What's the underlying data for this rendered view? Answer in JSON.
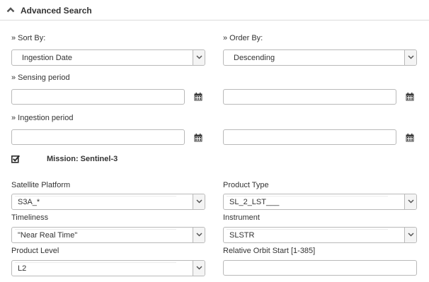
{
  "header": {
    "title": "Advanced Search",
    "icon": "chevron-up-icon"
  },
  "sort": {
    "label": "» Sort By:",
    "value": "Ingestion Date"
  },
  "order": {
    "label": "» Order By:",
    "value": "Descending"
  },
  "sensing": {
    "label": "» Sensing period",
    "start": "",
    "end": ""
  },
  "ingestion": {
    "label": "» Ingestion period",
    "start": "",
    "end": ""
  },
  "mission": {
    "label": "Mission: Sentinel-3",
    "checked": true
  },
  "fields": {
    "satellite_platform": {
      "label": "Satellite Platform",
      "value": "S3A_*"
    },
    "product_type": {
      "label": "Product Type",
      "value": "SL_2_LST___"
    },
    "timeliness": {
      "label": "Timeliness",
      "value": "\"Near Real Time\""
    },
    "instrument": {
      "label": "Instrument",
      "value": "SLSTR"
    },
    "product_level": {
      "label": "Product Level",
      "value": "L2"
    },
    "relative_orbit": {
      "label": "Relative Orbit Start [1-385]",
      "value": ""
    }
  },
  "icons": [
    "chevron-up-icon",
    "calendar-icon",
    "chevron-down-icon",
    "checkbox-checked-icon"
  ]
}
